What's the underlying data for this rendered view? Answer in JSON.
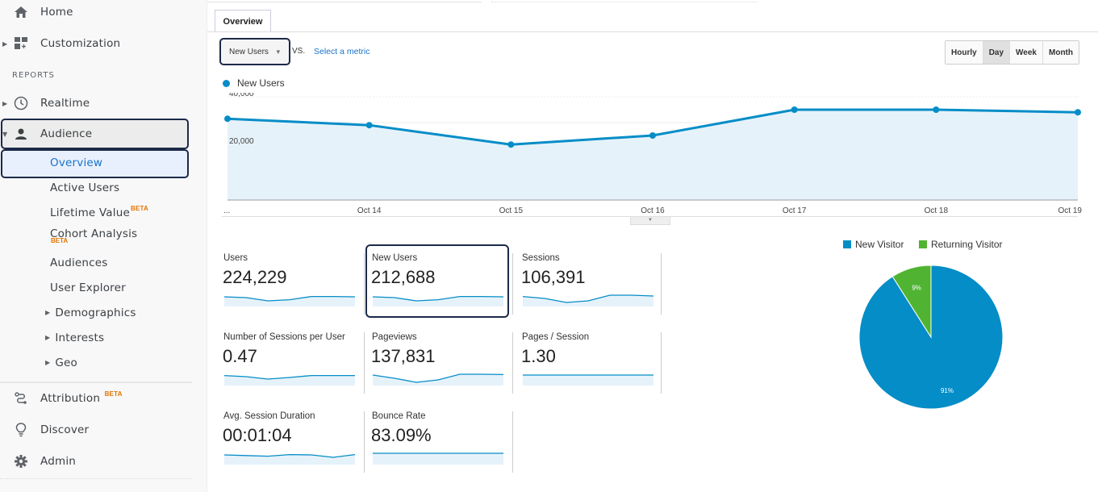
{
  "sidebar": {
    "home": "Home",
    "customization": "Customization",
    "reports_label": "REPORTS",
    "realtime": "Realtime",
    "audience": "Audience",
    "audience_items": {
      "overview": "Overview",
      "active_users": "Active Users",
      "lifetime_value": "Lifetime Value",
      "cohort_analysis": "Cohort Analysis",
      "audiences": "Audiences",
      "user_explorer": "User Explorer",
      "demographics": "Demographics",
      "interests": "Interests",
      "geo": "Geo"
    },
    "beta": "BETA",
    "attribution": "Attribution",
    "discover": "Discover",
    "admin": "Admin"
  },
  "main": {
    "tab": "Overview",
    "metric_select": "New Users",
    "vs": "VS.",
    "select_metric": "Select a metric",
    "granularity": [
      "Hourly",
      "Day",
      "Week",
      "Month"
    ],
    "granularity_active": "Day",
    "legend": "New Users",
    "collapse_arrow": "▼"
  },
  "cards": [
    {
      "title": "Users",
      "value": "224,229",
      "spark": [
        0.6,
        0.55,
        0.35,
        0.42,
        0.62,
        0.62,
        0.6
      ]
    },
    {
      "title": "New Users",
      "value": "212,688",
      "spark": [
        0.6,
        0.55,
        0.35,
        0.42,
        0.62,
        0.62,
        0.6
      ]
    },
    {
      "title": "Sessions",
      "value": "106,391",
      "spark": [
        0.62,
        0.5,
        0.25,
        0.35,
        0.7,
        0.7,
        0.65
      ]
    },
    {
      "title": "Number of Sessions per User",
      "value": "0.47",
      "spark": [
        0.62,
        0.55,
        0.4,
        0.5,
        0.62,
        0.62,
        0.62
      ]
    },
    {
      "title": "Pageviews",
      "value": "137,831",
      "spark": [
        0.65,
        0.45,
        0.2,
        0.35,
        0.7,
        0.7,
        0.68
      ]
    },
    {
      "title": "Pages / Session",
      "value": "1.30",
      "spark": [
        0.65,
        0.65,
        0.65,
        0.65,
        0.65,
        0.65,
        0.65
      ]
    },
    {
      "title": "Avg. Session Duration",
      "value": "00:01:04",
      "spark": [
        0.6,
        0.56,
        0.52,
        0.62,
        0.6,
        0.45,
        0.62
      ]
    },
    {
      "title": "Bounce Rate",
      "value": "83.09%",
      "spark": [
        0.7,
        0.7,
        0.7,
        0.7,
        0.7,
        0.7,
        0.7
      ]
    }
  ],
  "chart_data": [
    {
      "type": "area",
      "title": "",
      "series": [
        {
          "name": "New Users",
          "values": [
            31500,
            29000,
            21500,
            25000,
            35000,
            35000,
            34000
          ]
        }
      ],
      "x": [
        "...",
        "Oct 14",
        "Oct 15",
        "Oct 16",
        "Oct 17",
        "Oct 18",
        "Oct 19"
      ],
      "ytick_labels": [
        "40,000",
        "20,000"
      ],
      "ylim": [
        0,
        40000
      ],
      "xlabel": "",
      "ylabel": "",
      "grid": true,
      "color": "#058dc7"
    },
    {
      "type": "pie",
      "title": "",
      "categories": [
        "New Visitor",
        "Returning Visitor"
      ],
      "values": [
        91,
        9
      ],
      "labels": [
        "91%",
        "9%"
      ],
      "colors": [
        "#058dc7",
        "#50b432"
      ],
      "legend": "top"
    }
  ]
}
